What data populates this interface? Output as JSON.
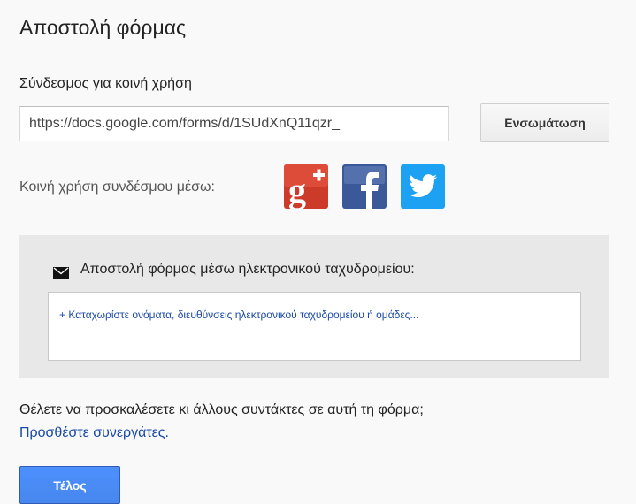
{
  "dialog": {
    "title": "Αποστολή φόρμας",
    "link_label": "Σύνδεσμος για κοινή χρήση",
    "share_url": "https://docs.google.com/forms/d/1SUdXnQ11qzr_",
    "embed_label": "Ενσωμάτωση",
    "share_via_label": "Κοινή χρήση συνδέσμου μέσω:",
    "social_icons": [
      "google-plus-icon",
      "facebook-icon",
      "twitter-icon"
    ],
    "email": {
      "icon": "envelope-icon",
      "heading": "Αποστολή φόρμας μέσω ηλεκτρονικού ταχυδρομείου:",
      "recipients_placeholder": "+ Καταχωρίστε ονόματα, διευθύνσεις ηλεκτρονικού ταχυδρομείου ή ομάδες..."
    },
    "invite_text": "Θέλετε να προσκαλέσετε κι άλλους συντάκτες σε αυτή τη φόρμα;",
    "add_collaborators_link": "Προσθέστε συνεργάτες.",
    "done_label": "Τέλος"
  },
  "colors": {
    "google_plus": "#dd4b39",
    "facebook": "#3b5998",
    "twitter": "#1da1f2",
    "link": "#1a4aa8",
    "primary_button": "#4d90fe"
  }
}
